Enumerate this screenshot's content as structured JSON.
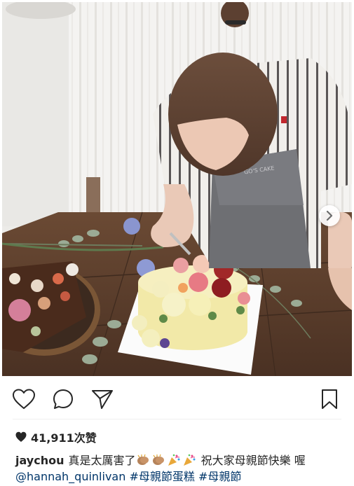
{
  "post": {
    "likes_text": "41,911次赞",
    "caption": {
      "username": "jaychou",
      "text_line1": "真是太厲害了",
      "text_line1_after": "祝大家母親節快樂",
      "text_line2_start": "喔",
      "mention": "@hannah_quinlivan",
      "hashtags": [
        "#母親節蛋糕",
        "#母親節"
      ]
    },
    "apron_text": "GO'S CAKE",
    "emojis": [
      "clapping-hands",
      "clapping-hands",
      "party-popper",
      "party-popper"
    ]
  },
  "icons": {
    "like": "heart-outline-icon",
    "comment": "comment-bubble-icon",
    "share": "paper-plane-icon",
    "save": "bookmark-icon",
    "next": "chevron-right-icon",
    "likes_heart": "heart-filled-icon"
  },
  "colors": {
    "text": "#262626",
    "link": "#003569",
    "divider": "#efefef"
  }
}
